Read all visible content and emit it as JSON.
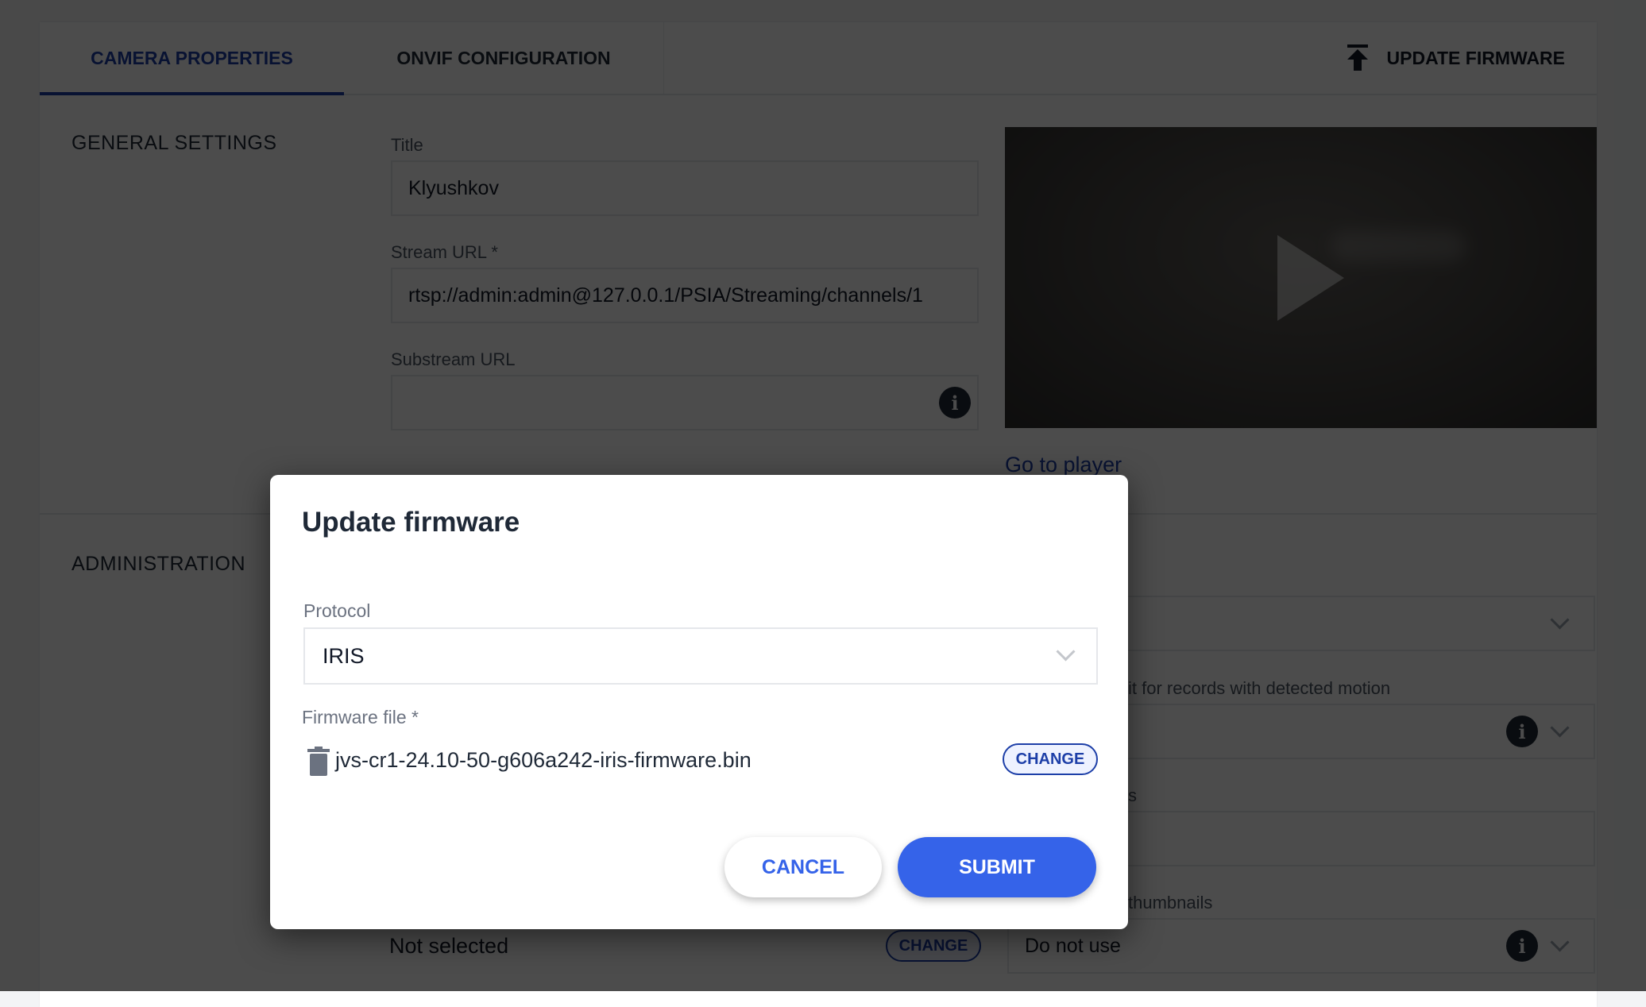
{
  "tabs": [
    {
      "label": "CAMERA PROPERTIES",
      "active": true
    },
    {
      "label": "ONVIF CONFIGURATION",
      "active": false
    }
  ],
  "header_action": {
    "label": "UPDATE FIRMWARE",
    "icon": "upload-icon"
  },
  "general_settings": {
    "section_title": "GENERAL SETTINGS",
    "title_label": "Title",
    "title_value": "Klyushkov",
    "stream_url_label": "Stream URL *",
    "stream_url_value": "rtsp://admin:admin@127.0.0.1/PSIA/Streaming/channels/1",
    "substream_url_label": "Substream URL",
    "substream_url_value": "",
    "go_to_player": "Go to player"
  },
  "administration": {
    "section_title": "ADMINISTRATION",
    "motion_label_partial": "it for records with detected motion",
    "field3_label_partial": "s",
    "thumbnails_label_partial": "thumbnails",
    "thumbnails_value": "Do not use",
    "file_value": "Not selected",
    "change_label": "CHANGE"
  },
  "dialog": {
    "title": "Update firmware",
    "protocol_label": "Protocol",
    "protocol_value": "IRIS",
    "firmware_label": "Firmware file *",
    "firmware_file": "jvs-cr1-24.10-50-g606a242-iris-firmware.bin",
    "change_label": "CHANGE",
    "cancel_label": "CANCEL",
    "submit_label": "SUBMIT"
  },
  "colors": {
    "accent": "#1d3fa8",
    "primary_button": "#3563e9",
    "overlay": "rgba(0,0,0,0.70)"
  }
}
